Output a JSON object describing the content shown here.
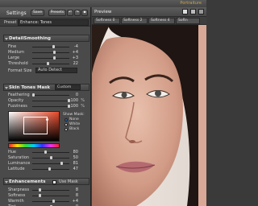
{
  "app": {
    "name": "Portraiture"
  },
  "settings": {
    "title": "Settings",
    "save_label": "Save",
    "presets_label": "Presets",
    "preset_label": "Preset",
    "preset_value": "Enhance: Tones"
  },
  "detail": {
    "title": "DetailSmoothing",
    "sliders": [
      {
        "label": "Fine",
        "value": "-4",
        "pos": 0.56
      },
      {
        "label": "Medium",
        "value": "+4",
        "pos": 0.6
      },
      {
        "label": "Large",
        "value": "+3",
        "pos": 0.58
      },
      {
        "label": "Threshold",
        "value": "22",
        "pos": 0.42
      }
    ],
    "format_label": "Format Size",
    "format_value": "Auto Detect"
  },
  "skin": {
    "title": "Skin Tones Mask",
    "mode": "Custom",
    "sliders": [
      {
        "label": "Feathering",
        "value": "0",
        "pct": "",
        "pos": 0.0
      },
      {
        "label": "Opacity",
        "value": "100",
        "pct": "%",
        "pos": 1.0
      },
      {
        "label": "Fuzziness",
        "value": "100",
        "pct": "%",
        "pos": 1.0
      }
    ],
    "show_mask_label": "Show Mask:",
    "show_mask_options": [
      "None",
      "White",
      "Black"
    ],
    "hsl": [
      {
        "label": "Hue",
        "value": "80",
        "pos": 0.34
      },
      {
        "label": "Saturation",
        "value": "50",
        "pos": 0.5
      },
      {
        "label": "Luminance",
        "value": "81",
        "pos": 0.79
      },
      {
        "label": "Latitude",
        "value": "47",
        "pos": 0.46
      }
    ]
  },
  "enh": {
    "title": "Enhancements",
    "use_mask_label": "Use Mask",
    "sliders": [
      {
        "label": "Sharpness",
        "value": "8",
        "pos": 0.18
      },
      {
        "label": "Softness",
        "value": "8",
        "pos": 0.18
      },
      {
        "label": "Warmth",
        "value": "+4",
        "pos": 0.56
      },
      {
        "label": "Tint",
        "value": "0",
        "pos": 0.5
      }
    ]
  },
  "preview": {
    "title": "Preview",
    "tabs": [
      "Softness 0",
      "Softness 2",
      "Softness 4",
      "Softn"
    ]
  },
  "colors": {
    "accent": "#c9a64a",
    "panel": "#4a4a4a",
    "selected_radio": "#2a6fd6"
  }
}
